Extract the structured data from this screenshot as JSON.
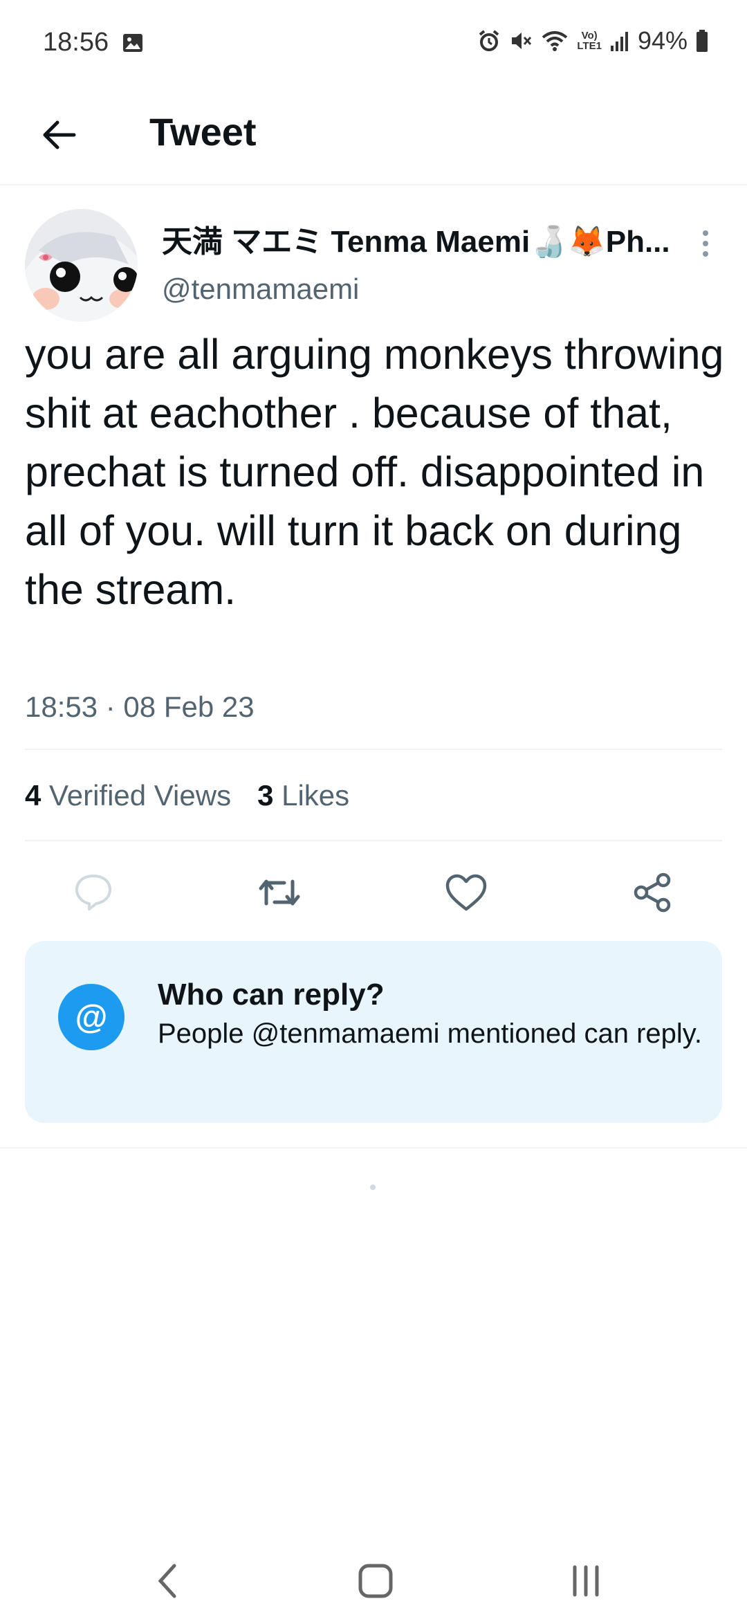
{
  "status_bar": {
    "time": "18:56",
    "network_label_top": "Vo)",
    "network_label_bottom": "LTE1",
    "battery": "94%",
    "icons": [
      "gallery-icon",
      "alarm-icon",
      "mute-icon",
      "wifi-icon",
      "signal-icon",
      "battery-icon"
    ]
  },
  "header": {
    "title": "Tweet",
    "back_icon": "arrow-left-icon"
  },
  "tweet": {
    "author_name": "天満 マエミ Tenma Maemi🍶🦊Ph...",
    "author_handle": "@tenmamaemi",
    "text": "you are all arguing monkeys throwing shit at eachother . because of that, prechat is turned off. disappointed in all of you. will turn it back on during the stream.",
    "timestamp": "18:53 · 08 Feb 23",
    "views_count": "4",
    "views_label": "Verified Views",
    "likes_count": "3",
    "likes_label": "Likes"
  },
  "actions": {
    "icons": [
      "reply-icon",
      "retweet-icon",
      "like-icon",
      "share-icon"
    ]
  },
  "reply_card": {
    "icon": "@",
    "title": "Who can reply?",
    "description": "People @tenmamaemi mentioned can reply."
  },
  "colors": {
    "primary_text": "#0f1419",
    "secondary_text": "#536471",
    "accent": "#1d9bf0",
    "card_bg": "#e8f5fd",
    "divider": "#eff3f4"
  }
}
